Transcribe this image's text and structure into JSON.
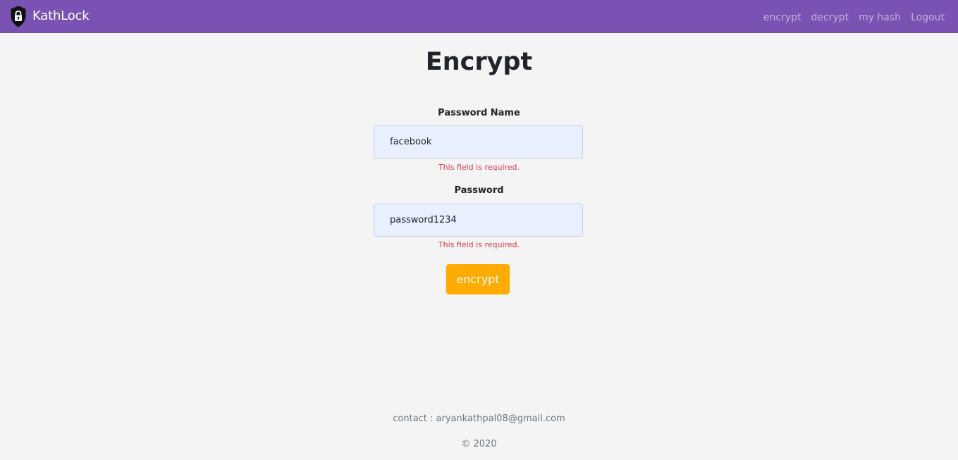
{
  "navbar": {
    "brand": "KathLock",
    "links": [
      "encrypt",
      "decrypt",
      "my hash",
      "Logout"
    ]
  },
  "main": {
    "title": "Encrypt",
    "password_name": {
      "label": "Password Name",
      "value": "facebook",
      "error": "This field is required."
    },
    "password": {
      "label": "Password",
      "value": "password1234",
      "error": "This field is required."
    },
    "submit_label": "encrypt"
  },
  "footer": {
    "contact": "contact : aryankathpal08@gmail.com",
    "copyright": "© 2020"
  },
  "colors": {
    "navbar": "#7952b3",
    "button": "#ffab00",
    "error": "#dc3545",
    "input_bg": "#e8f0fe"
  }
}
